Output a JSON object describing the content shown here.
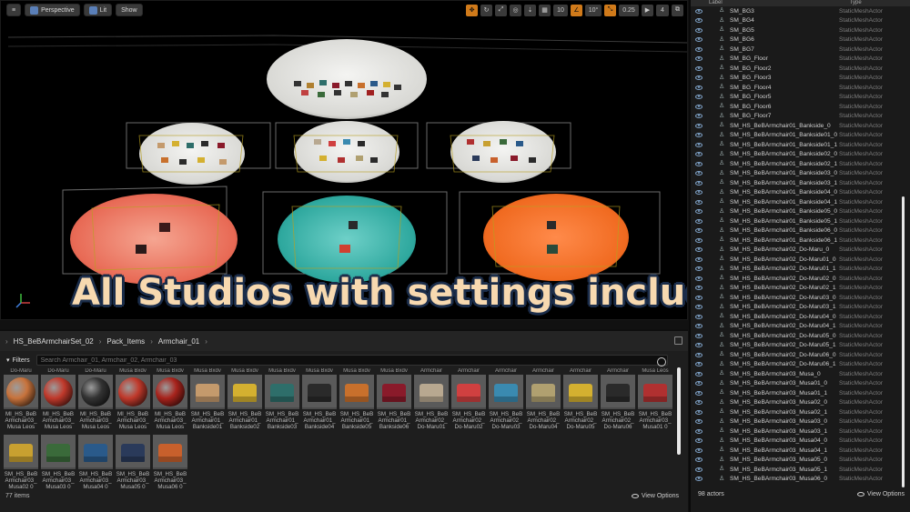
{
  "viewport": {
    "mode_label": "Perspective",
    "lit_label": "Lit",
    "show_label": "Show",
    "grid_snap": "10",
    "rotation_snap": "10°",
    "scale_snap": "0.25",
    "camera_speed": "4"
  },
  "banner": {
    "text": "All Studios with settings included"
  },
  "content_browser": {
    "breadcrumb": [
      "HS_BeBArmchairSet_02",
      "Pack_Items",
      "Armchair_01"
    ],
    "filters_label": "Filters",
    "search_placeholder": "Search Armchair_01, Armchair_02, Armchair_03",
    "item_count": "77 items",
    "view_options_label": "View Options",
    "assets": [
      {
        "top": "Do-Maru",
        "line1": "MI_HS_BeB",
        "line2": "Armchair03_",
        "line3": "Musa Leos",
        "thumb": "sphere",
        "color": "#c8733c"
      },
      {
        "top": "Do-Maru",
        "line1": "MI_HS_BeB",
        "line2": "Armchair03_",
        "line3": "Musa Leos",
        "thumb": "sphere",
        "color": "#c0392b"
      },
      {
        "top": "Do-Maru",
        "line1": "MI_HS_BeB",
        "line2": "Armchair03_",
        "line3": "Musa Leos",
        "thumb": "sphere",
        "color": "#333333"
      },
      {
        "top": "Musa Bxdv",
        "line1": "MI_HS_BeB",
        "line2": "Armchair03_",
        "line3": "Musa Leos",
        "thumb": "sphere",
        "color": "#c0392b"
      },
      {
        "top": "Musa Bxdv",
        "line1": "MI_HS_BeB",
        "line2": "Armchair03_",
        "line3": "Musa Leos",
        "thumb": "sphere",
        "color": "#a8231c"
      },
      {
        "top": "Musa Bxdv",
        "line1": "SM_HS_BeB",
        "line2": "Armchair01_",
        "line3": "Bankside01",
        "thumb": "chair",
        "color": "#c49a6c"
      },
      {
        "top": "Musa Bxdv",
        "line1": "SM_HS_BeB",
        "line2": "Armchair01_",
        "line3": "Bankside02",
        "thumb": "chair",
        "color": "#d4b030"
      },
      {
        "top": "Musa Bxdv",
        "line1": "SM_HS_BeB",
        "line2": "Armchair01_",
        "line3": "Bankside03",
        "thumb": "chair",
        "color": "#2e6e6a"
      },
      {
        "top": "Musa Bxdv",
        "line1": "SM_HS_BeB",
        "line2": "Armchair01_",
        "line3": "Bankside04",
        "thumb": "chair",
        "color": "#2a2a2a"
      },
      {
        "top": "Musa Bxdv",
        "line1": "SM_HS_BeB",
        "line2": "Armchair01_",
        "line3": "Bankside05",
        "thumb": "chair",
        "color": "#c8702c"
      },
      {
        "top": "Musa Bxdv",
        "line1": "SM_HS_BeB",
        "line2": "Armchair01_",
        "line3": "Bankside06",
        "thumb": "chair",
        "color": "#8a1a2a"
      },
      {
        "top": "Armchair",
        "line1": "SM_HS_BeB",
        "line2": "Armchair02_",
        "line3": "Do-Maru01",
        "thumb": "chair",
        "color": "#b8a890"
      },
      {
        "top": "Armchair",
        "line1": "SM_HS_BeB",
        "line2": "Armchair02_",
        "line3": "Do-Maru02",
        "thumb": "chair",
        "color": "#d04040"
      },
      {
        "top": "Armchair",
        "line1": "SM_HS_BeB",
        "line2": "Armchair02_",
        "line3": "Do-Maru03",
        "thumb": "chair",
        "color": "#3a8ab0"
      },
      {
        "top": "Armchair",
        "line1": "SM_HS_BeB",
        "line2": "Armchair02_",
        "line3": "Do-Maru04",
        "thumb": "chair",
        "color": "#b0a070"
      },
      {
        "top": "Armchair",
        "line1": "SM_HS_BeB",
        "line2": "Armchair02_",
        "line3": "Do-Maru05",
        "thumb": "chair",
        "color": "#d4b030"
      },
      {
        "top": "Armchair",
        "line1": "SM_HS_BeB",
        "line2": "Armchair02_",
        "line3": "Do-Maru06",
        "thumb": "chair",
        "color": "#2a2a2a"
      },
      {
        "top": "Musa Leos",
        "line1": "SM_HS_BeB",
        "line2": "Armchair03_",
        "line3": "Musa01 0",
        "thumb": "chair",
        "color": "#b03030"
      },
      {
        "top": "",
        "line1": "SM_HS_BeB",
        "line2": "Armchair03_",
        "line3": "Musa02 0",
        "thumb": "chair",
        "color": "#c8a030"
      },
      {
        "top": "",
        "line1": "SM_HS_BeB",
        "line2": "Armchair03_",
        "line3": "Musa03 0",
        "thumb": "chair",
        "color": "#3a6a3a"
      },
      {
        "top": "",
        "line1": "SM_HS_BeB",
        "line2": "Armchair03_",
        "line3": "Musa04 0",
        "thumb": "chair",
        "color": "#2a5a8a"
      },
      {
        "top": "",
        "line1": "SM_HS_BeB",
        "line2": "Armchair03_",
        "line3": "Musa05 0",
        "thumb": "chair",
        "color": "#2a3a5a"
      },
      {
        "top": "",
        "line1": "SM_HS_BeB",
        "line2": "Armchair03_",
        "line3": "Musa06 0",
        "thumb": "chair",
        "color": "#c8602c"
      }
    ]
  },
  "outliner": {
    "header_label": "Label",
    "header_type": "Type",
    "actor_count": "98 actors",
    "view_options_label": "View Options",
    "rows": [
      {
        "name": "SM_BG3",
        "type": "StaticMeshActor"
      },
      {
        "name": "SM_BG4",
        "type": "StaticMeshActor"
      },
      {
        "name": "SM_BG5",
        "type": "StaticMeshActor"
      },
      {
        "name": "SM_BG6",
        "type": "StaticMeshActor"
      },
      {
        "name": "SM_BG7",
        "type": "StaticMeshActor"
      },
      {
        "name": "SM_BG_Floor",
        "type": "StaticMeshActor"
      },
      {
        "name": "SM_BG_Floor2",
        "type": "StaticMeshActor"
      },
      {
        "name": "SM_BG_Floor3",
        "type": "StaticMeshActor"
      },
      {
        "name": "SM_BG_Floor4",
        "type": "StaticMeshActor"
      },
      {
        "name": "SM_BG_Floor5",
        "type": "StaticMeshActor"
      },
      {
        "name": "SM_BG_Floor6",
        "type": "StaticMeshActor"
      },
      {
        "name": "SM_BG_Floor7",
        "type": "StaticMeshActor"
      },
      {
        "name": "SM_HS_BeBArmchair01_Bankside_0",
        "type": "StaticMeshActor"
      },
      {
        "name": "SM_HS_BeBArmchair01_Bankside01_0",
        "type": "StaticMeshActor"
      },
      {
        "name": "SM_HS_BeBArmchair01_Bankside01_1",
        "type": "StaticMeshActor"
      },
      {
        "name": "SM_HS_BeBArmchair01_Bankside02_0",
        "type": "StaticMeshActor"
      },
      {
        "name": "SM_HS_BeBArmchair01_Bankside02_1",
        "type": "StaticMeshActor"
      },
      {
        "name": "SM_HS_BeBArmchair01_Bankside03_0",
        "type": "StaticMeshActor"
      },
      {
        "name": "SM_HS_BeBArmchair01_Bankside03_1",
        "type": "StaticMeshActor"
      },
      {
        "name": "SM_HS_BeBArmchair01_Bankside04_0",
        "type": "StaticMeshActor"
      },
      {
        "name": "SM_HS_BeBArmchair01_Bankside04_1",
        "type": "StaticMeshActor"
      },
      {
        "name": "SM_HS_BeBArmchair01_Bankside05_0",
        "type": "StaticMeshActor"
      },
      {
        "name": "SM_HS_BeBArmchair01_Bankside05_1",
        "type": "StaticMeshActor"
      },
      {
        "name": "SM_HS_BeBArmchair01_Bankside06_0",
        "type": "StaticMeshActor"
      },
      {
        "name": "SM_HS_BeBArmchair01_Bankside06_1",
        "type": "StaticMeshActor"
      },
      {
        "name": "SM_HS_BeBArmchair02_Do-Maru_0",
        "type": "StaticMeshActor"
      },
      {
        "name": "SM_HS_BeBArmchair02_Do-Maru01_0",
        "type": "StaticMeshActor"
      },
      {
        "name": "SM_HS_BeBArmchair02_Do-Maru01_1",
        "type": "StaticMeshActor"
      },
      {
        "name": "SM_HS_BeBArmchair02_Do-Maru02_0",
        "type": "StaticMeshActor"
      },
      {
        "name": "SM_HS_BeBArmchair02_Do-Maru02_1",
        "type": "StaticMeshActor"
      },
      {
        "name": "SM_HS_BeBArmchair02_Do-Maru03_0",
        "type": "StaticMeshActor"
      },
      {
        "name": "SM_HS_BeBArmchair02_Do-Maru03_1",
        "type": "StaticMeshActor"
      },
      {
        "name": "SM_HS_BeBArmchair02_Do-Maru04_0",
        "type": "StaticMeshActor"
      },
      {
        "name": "SM_HS_BeBArmchair02_Do-Maru04_1",
        "type": "StaticMeshActor"
      },
      {
        "name": "SM_HS_BeBArmchair02_Do-Maru05_0",
        "type": "StaticMeshActor"
      },
      {
        "name": "SM_HS_BeBArmchair02_Do-Maru05_1",
        "type": "StaticMeshActor"
      },
      {
        "name": "SM_HS_BeBArmchair02_Do-Maru06_0",
        "type": "StaticMeshActor"
      },
      {
        "name": "SM_HS_BeBArmchair02_Do-Maru06_1",
        "type": "StaticMeshActor"
      },
      {
        "name": "SM_HS_BeBArmchair03_Musa_0",
        "type": "StaticMeshActor"
      },
      {
        "name": "SM_HS_BeBArmchair03_Musa01_0",
        "type": "StaticMeshActor"
      },
      {
        "name": "SM_HS_BeBArmchair03_Musa01_1",
        "type": "StaticMeshActor"
      },
      {
        "name": "SM_HS_BeBArmchair03_Musa02_0",
        "type": "StaticMeshActor"
      },
      {
        "name": "SM_HS_BeBArmchair03_Musa02_1",
        "type": "StaticMeshActor"
      },
      {
        "name": "SM_HS_BeBArmchair03_Musa03_0",
        "type": "StaticMeshActor"
      },
      {
        "name": "SM_HS_BeBArmchair03_Musa03_1",
        "type": "StaticMeshActor"
      },
      {
        "name": "SM_HS_BeBArmchair03_Musa04_0",
        "type": "StaticMeshActor"
      },
      {
        "name": "SM_HS_BeBArmchair03_Musa04_1",
        "type": "StaticMeshActor"
      },
      {
        "name": "SM_HS_BeBArmchair03_Musa05_0",
        "type": "StaticMeshActor"
      },
      {
        "name": "SM_HS_BeBArmchair03_Musa05_1",
        "type": "StaticMeshActor"
      },
      {
        "name": "SM_HS_BeBArmchair03_Musa06_0",
        "type": "StaticMeshActor"
      }
    ]
  }
}
